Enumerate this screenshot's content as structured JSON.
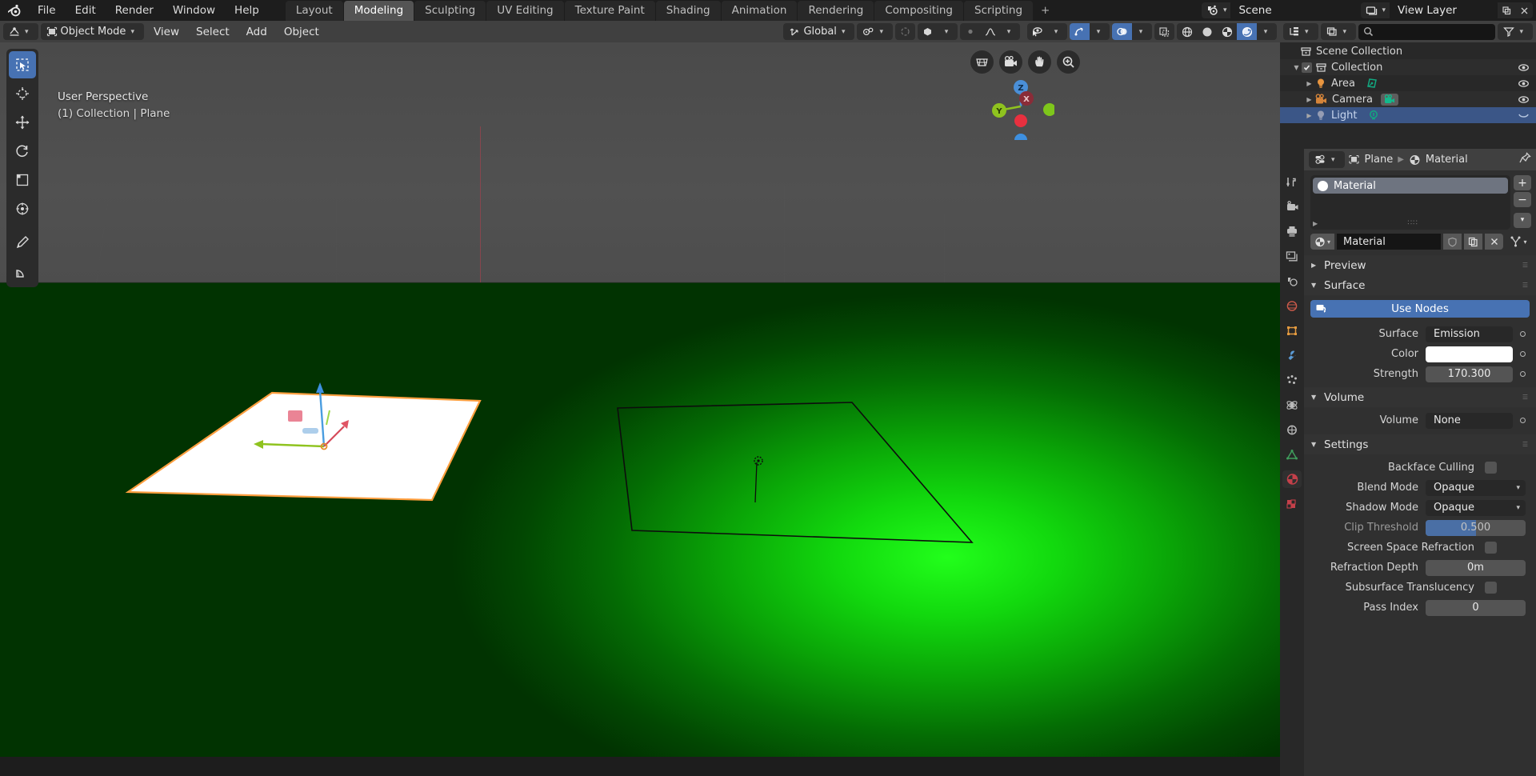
{
  "topbar": {
    "logo_icon": "blender-logo-icon",
    "menus": [
      "File",
      "Edit",
      "Render",
      "Window",
      "Help"
    ],
    "workspaces": [
      {
        "label": "Layout",
        "active": false
      },
      {
        "label": "Modeling",
        "active": true
      },
      {
        "label": "Sculpting",
        "active": false
      },
      {
        "label": "UV Editing",
        "active": false
      },
      {
        "label": "Texture Paint",
        "active": false
      },
      {
        "label": "Shading",
        "active": false
      },
      {
        "label": "Animation",
        "active": false
      },
      {
        "label": "Rendering",
        "active": false
      },
      {
        "label": "Compositing",
        "active": false
      },
      {
        "label": "Scripting",
        "active": false
      }
    ],
    "add_workspace_label": "+",
    "scene_icon": "scene-icon",
    "scene_name": "Scene",
    "viewlayer_icon": "view-layer-icon",
    "viewlayer_name": "View Layer"
  },
  "viewport_header": {
    "editor_type_icon": "editor-type-icon",
    "mode_icon": "object-mode-icon",
    "mode_label": "Object Mode",
    "menus": [
      "View",
      "Select",
      "Add",
      "Object"
    ],
    "transform_orientation_icon": "orientation-icon",
    "transform_orientation": "Global",
    "snap_icon": "magnet-icon",
    "proportional_edit_icon": "proportional-edit-icon",
    "proportional_falloff_icon": "falloff-curve-icon",
    "visibility_icon": "eye-cursor-icon",
    "gizmo_icon": "gizmo-icon",
    "overlays_icon": "overlays-icon",
    "xray_icon": "xray-icon",
    "shading_modes": [
      "wireframe",
      "solid",
      "material-preview",
      "rendered"
    ],
    "shading_active": "rendered"
  },
  "viewport": {
    "perspective_label": "User Perspective",
    "context_label": "(1) Collection | Plane",
    "tools": [
      {
        "name": "select-box-tool",
        "active": true
      },
      {
        "name": "cursor-tool",
        "active": false
      },
      {
        "name": "move-tool",
        "active": false
      },
      {
        "name": "rotate-tool",
        "active": false
      },
      {
        "name": "scale-tool",
        "active": false
      },
      {
        "name": "transform-tool",
        "active": false
      },
      {
        "name": "annotate-tool",
        "active": false
      },
      {
        "name": "measure-tool",
        "active": false
      }
    ],
    "nav_buttons": [
      "toggle-camera-perspective-icon",
      "camera-view-icon",
      "pan-view-icon",
      "zoom-view-icon"
    ],
    "gizmo_axes": [
      {
        "label": "Z",
        "color": "#4a8fd8"
      },
      {
        "label": "Y",
        "color": "#8fc31f"
      },
      {
        "label": "X",
        "color": "#b33c4a"
      }
    ],
    "emissive_plane_color": "#ffffff",
    "ground_color": "#12d90e"
  },
  "outliner": {
    "display_mode_icon": "outliner-display-mode-icon",
    "filter_id_icon": "outliner-id-type-icon",
    "search_placeholder": "",
    "search_icon": "search-icon",
    "filter_icon": "filter-icon",
    "rows": [
      {
        "label": "Scene Collection",
        "icon": "collection-icon",
        "indent": 0,
        "expandable": false,
        "checkbox": false,
        "eye": false,
        "selected": false
      },
      {
        "label": "Collection",
        "icon": "collection-icon",
        "indent": 1,
        "expandable": true,
        "expanded": true,
        "checkbox": true,
        "eye": true,
        "selected": false
      },
      {
        "label": "Area",
        "icon": "light-icon",
        "data_icon": "area-light-data-icon",
        "indent": 2,
        "expandable": true,
        "expanded": false,
        "checkbox": false,
        "eye": true,
        "selected": false
      },
      {
        "label": "Camera",
        "icon": "camera-icon",
        "data_icon": "camera-data-icon",
        "indent": 2,
        "expandable": true,
        "expanded": false,
        "checkbox": false,
        "eye": true,
        "selected": false
      },
      {
        "label": "Light",
        "icon": "light-icon",
        "data_icon": "point-light-data-icon",
        "indent": 2,
        "expandable": true,
        "expanded": false,
        "checkbox": false,
        "eye": true,
        "selected": true
      }
    ]
  },
  "properties": {
    "editor_icon": "properties-editor-icon",
    "breadcrumb": [
      {
        "icon": "object-icon",
        "label": "Plane"
      },
      {
        "icon": "material-icon",
        "label": "Material"
      }
    ],
    "pin_icon": "pin-icon",
    "tabs": [
      {
        "name": "tool-tab",
        "icon": "tool-icon",
        "active": false
      },
      {
        "name": "render-tab",
        "icon": "render-icon",
        "active": false
      },
      {
        "name": "output-tab",
        "icon": "printer-icon",
        "active": false
      },
      {
        "name": "view-layer-tab",
        "icon": "images-icon",
        "active": false
      },
      {
        "name": "scene-tab",
        "icon": "scene-cone-icon",
        "active": false
      },
      {
        "name": "world-tab",
        "icon": "world-icon",
        "active": false
      },
      {
        "name": "object-tab",
        "icon": "object-square-icon",
        "active": false
      },
      {
        "name": "modifiers-tab",
        "icon": "wrench-icon",
        "active": false
      },
      {
        "name": "particles-tab",
        "icon": "particles-icon",
        "active": false
      },
      {
        "name": "physics-tab",
        "icon": "physics-icon",
        "active": false
      },
      {
        "name": "constraints-tab",
        "icon": "constraints-icon",
        "active": false
      },
      {
        "name": "data-tab",
        "icon": "green-triangle-data-icon",
        "active": false
      },
      {
        "name": "material-tab",
        "icon": "material-sphere-icon",
        "active": true
      },
      {
        "name": "texture-tab",
        "icon": "checker-texture-icon",
        "active": false
      }
    ],
    "material_slots": [
      {
        "name": "Material",
        "preview_color": "#ffffff",
        "selected": true
      }
    ],
    "slot_add_label": "+",
    "slot_remove_label": "−",
    "slot_menu_icon": "chevron-down-icon",
    "slot_expand_icon": "expand-arrow-icon",
    "material_browse_icon": "material-icon",
    "material_name": "Material",
    "fake_user_icon": "shield-icon",
    "new_material_icon": "copy-icon",
    "unlink_icon": "x-icon",
    "node_tree_icon": "nodetree-icon",
    "sections": {
      "preview": {
        "title": "Preview",
        "expanded": false
      },
      "surface": {
        "title": "Surface",
        "expanded": true,
        "use_nodes_label": "Use Nodes",
        "use_nodes_icon": "nodes-icon",
        "rows": [
          {
            "label": "Surface",
            "value": "Emission",
            "type": "dropdown-dark",
            "socket": true
          },
          {
            "label": "Color",
            "value": "",
            "type": "color",
            "color": "#ffffff",
            "socket": true
          },
          {
            "label": "Strength",
            "value": "170.300",
            "type": "number",
            "socket": true
          }
        ]
      },
      "volume": {
        "title": "Volume",
        "expanded": true,
        "rows": [
          {
            "label": "Volume",
            "value": "None",
            "type": "dropdown-dark",
            "socket": true
          }
        ]
      },
      "settings": {
        "title": "Settings",
        "expanded": true,
        "rows": [
          {
            "label": "Backface Culling",
            "value": "",
            "type": "checkbox",
            "checked": false
          },
          {
            "label": "Blend Mode",
            "value": "Opaque",
            "type": "dropdown"
          },
          {
            "label": "Shadow Mode",
            "value": "Opaque",
            "type": "dropdown"
          },
          {
            "label": "Clip Threshold",
            "value": "0.500",
            "type": "slider",
            "dim": true,
            "fill_pct": 50
          },
          {
            "label": "Screen Space Refraction",
            "value": "",
            "type": "checkbox",
            "checked": false
          },
          {
            "label": "Refraction Depth",
            "value": "0m",
            "type": "number"
          },
          {
            "label": "Subsurface Translucency",
            "value": "",
            "type": "checkbox",
            "checked": false
          },
          {
            "label": "Pass Index",
            "value": "0",
            "type": "number"
          }
        ]
      }
    }
  },
  "colors": {
    "accent_blue": "#4772b3",
    "header_gray": "#404040",
    "panel_gray": "#303030",
    "dark_bg": "#1d1d1d",
    "selected_row": "#3b5687"
  }
}
